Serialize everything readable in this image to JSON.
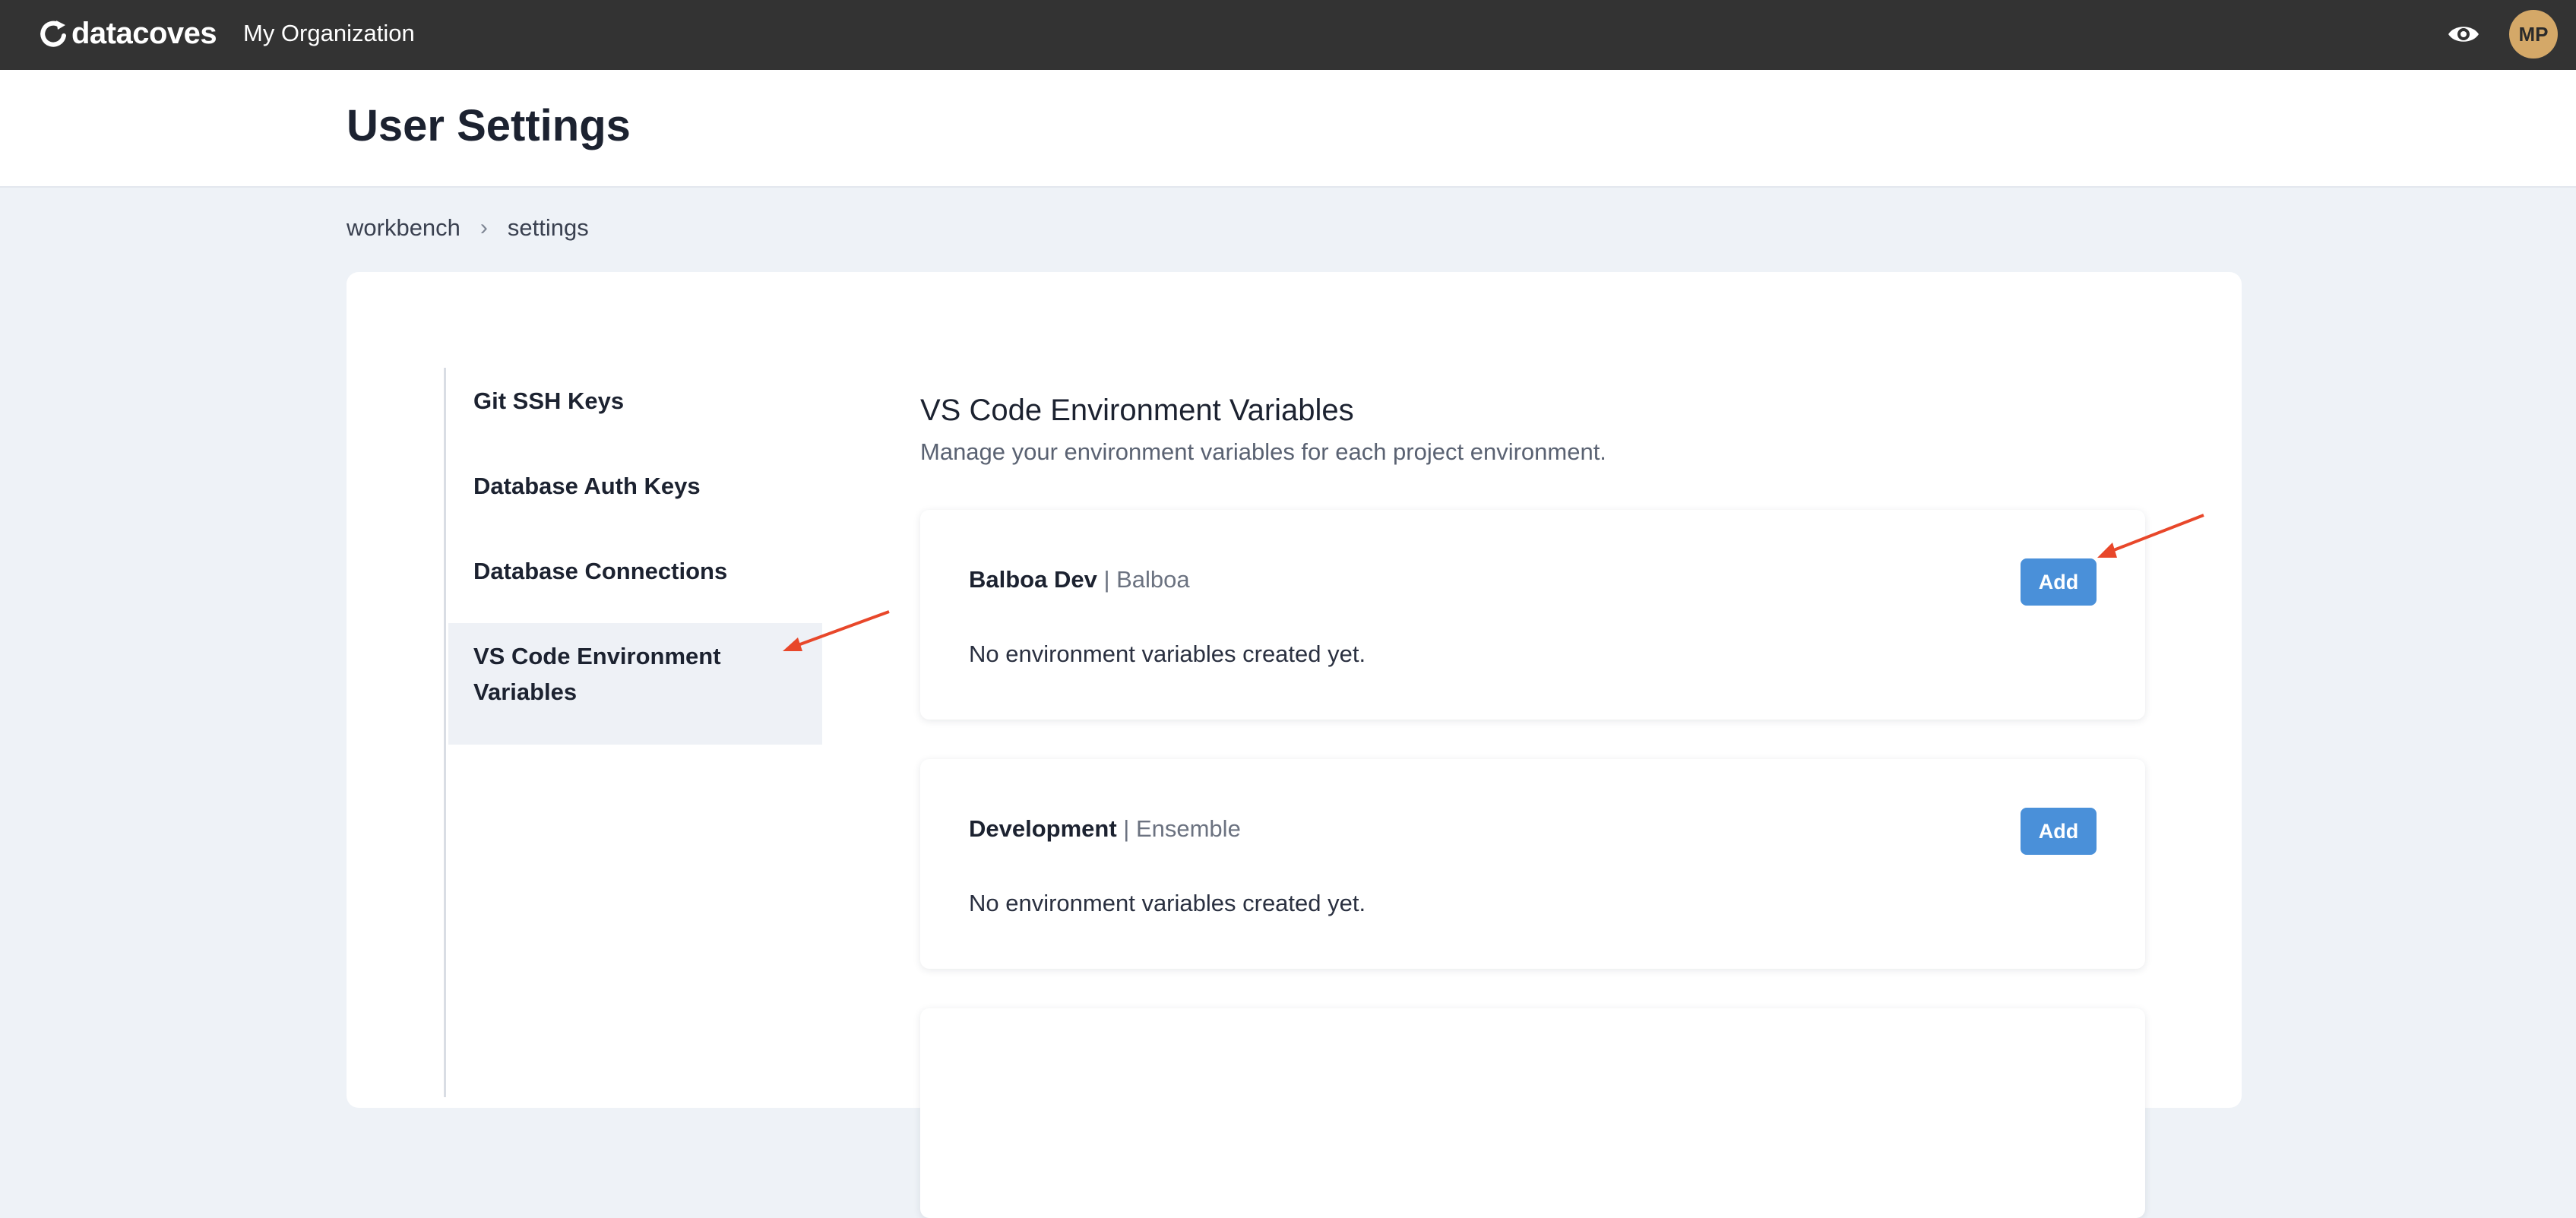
{
  "topbar": {
    "logo_text": "datacoves",
    "org_name": "My Organization",
    "preview_icon": "eye-icon",
    "avatar_initials": "MP",
    "avatar_color": "#d4a868",
    "bar_color": "#333333"
  },
  "page": {
    "title": "User Settings"
  },
  "breadcrumb": {
    "items": [
      "workbench",
      "settings"
    ],
    "separator": "›"
  },
  "sidebar": {
    "items": [
      {
        "label": "Git SSH Keys",
        "active": false
      },
      {
        "label": "Database Auth Keys",
        "active": false
      },
      {
        "label": "Database Connections",
        "active": false
      },
      {
        "label": "VS Code Environment Variables",
        "active": true
      }
    ]
  },
  "main": {
    "title": "VS Code Environment Variables",
    "subtitle": "Manage your environment variables for each project environment.",
    "environments": [
      {
        "name": "Balboa Dev",
        "separator": " | ",
        "project": "Balboa",
        "empty_text": "No environment variables created yet.",
        "add_label": "Add"
      },
      {
        "name": "Development",
        "separator": " | ",
        "project": "Ensemble",
        "empty_text": "No environment variables created yet.",
        "add_label": "Add"
      }
    ]
  },
  "colors": {
    "accent": "#4a90d9",
    "annotation_arrow": "#e8472a"
  }
}
